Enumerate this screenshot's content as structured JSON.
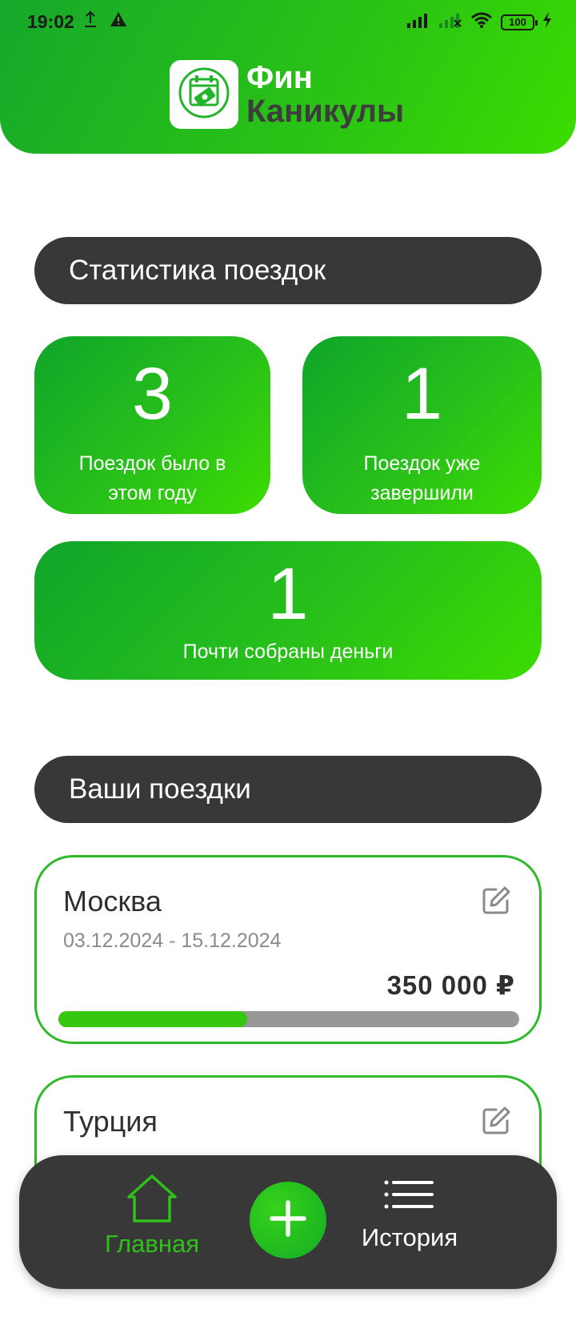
{
  "status_bar": {
    "time": "19:02",
    "battery": "100"
  },
  "app": {
    "logo_line1": "Фин",
    "logo_line2": "Каникулы"
  },
  "stats_section": {
    "title": "Статистика поездок",
    "cards": [
      {
        "number": "3",
        "label": "Поездок было в этом году"
      },
      {
        "number": "1",
        "label": "Поездок уже завершили"
      },
      {
        "number": "1",
        "label": "Почти собраны деньги"
      }
    ]
  },
  "trips_section": {
    "title": "Ваши поездки",
    "trips": [
      {
        "name": "Москва",
        "dates": "03.12.2024 - 15.12.2024",
        "amount": "350 000 ₽",
        "progress": 0.41
      },
      {
        "name": "Турция"
      }
    ]
  },
  "bottom_nav": {
    "home_label": "Главная",
    "history_label": "История"
  },
  "colors": {
    "accent": "#2bc414",
    "dark": "#383838",
    "progress_track": "#989898"
  },
  "icons": [
    "upload-icon",
    "warning-icon",
    "signal-icon",
    "no-signal-icon",
    "wifi-icon",
    "charging-icon",
    "wallet-calendar-icon",
    "edit-icon",
    "home-icon",
    "plus-icon",
    "list-icon"
  ]
}
